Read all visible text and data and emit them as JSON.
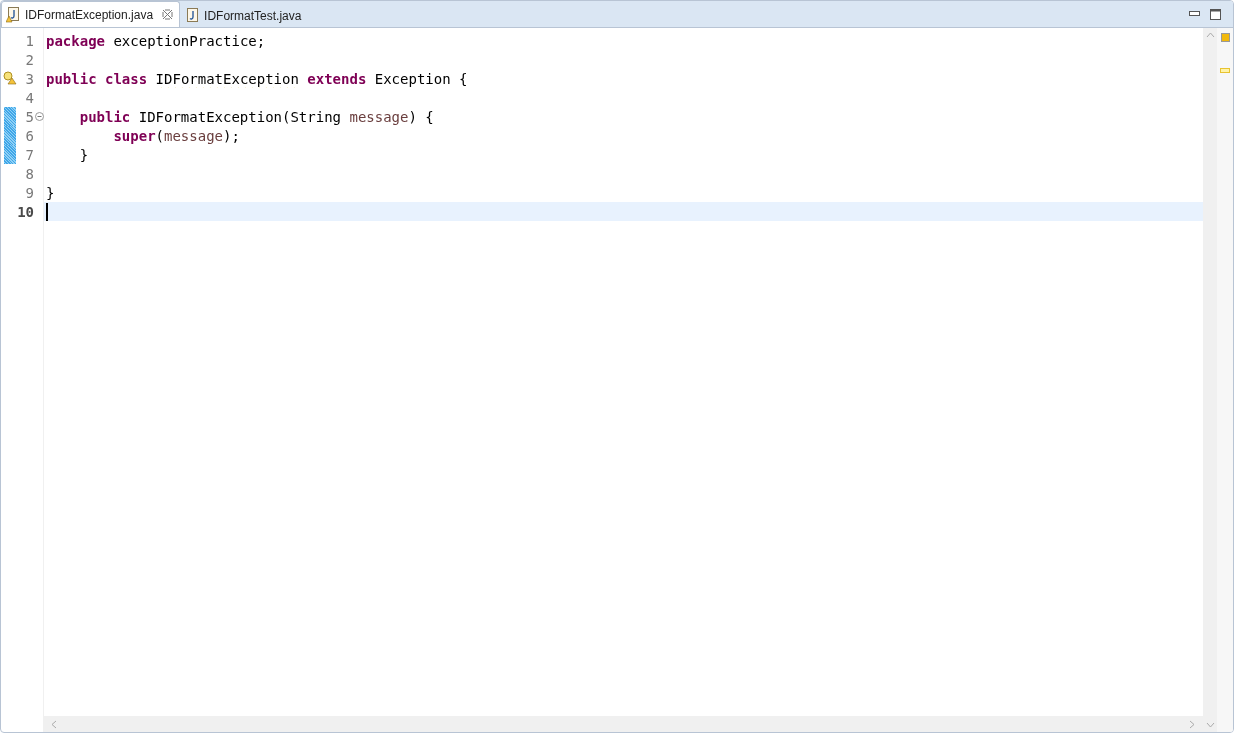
{
  "tabs": [
    {
      "label": "IDFormatException.java",
      "selected": true,
      "warning": true
    },
    {
      "label": "IDFormatTest.java",
      "selected": false,
      "warning": false
    }
  ],
  "lines": [
    {
      "number": "1",
      "changed": false,
      "warning": false,
      "folding": false,
      "current": false,
      "tokens": [
        {
          "kind": "keyword",
          "text": "package"
        },
        {
          "kind": "plain",
          "text": " exceptionPractice;"
        }
      ]
    },
    {
      "number": "2",
      "changed": false,
      "warning": false,
      "folding": false,
      "current": false
    },
    {
      "number": "3",
      "changed": false,
      "warning": true,
      "folding": false,
      "current": false,
      "tokens": [
        {
          "kind": "keyword",
          "text": "public"
        },
        {
          "kind": "keyword",
          "text": " class "
        },
        {
          "kind": "warned",
          "text": "IDFormatException"
        },
        {
          "kind": "keyword",
          "text": " extends"
        },
        {
          "kind": "plain",
          "text": " Exception {"
        }
      ]
    },
    {
      "number": "4",
      "changed": false,
      "warning": false,
      "folding": false,
      "current": false
    },
    {
      "number": "5",
      "changed": true,
      "warning": false,
      "folding": true,
      "current": false,
      "tokens": [
        {
          "kind": "keyword",
          "text": "    public"
        },
        {
          "kind": "plain",
          "text": " IDFormatException(String "
        },
        {
          "kind": "param",
          "text": "message"
        },
        {
          "kind": "plain",
          "text": ") {"
        }
      ]
    },
    {
      "number": "6",
      "changed": true,
      "warning": false,
      "folding": false,
      "current": false,
      "tokens": [
        {
          "kind": "keyword",
          "text": "        super"
        },
        {
          "kind": "plain",
          "text": "("
        },
        {
          "kind": "param",
          "text": "message"
        },
        {
          "kind": "plain",
          "text": ");"
        }
      ]
    },
    {
      "number": "7",
      "changed": true,
      "warning": false,
      "folding": false,
      "current": false,
      "tokens": [
        {
          "kind": "plain",
          "text": "    }"
        }
      ]
    },
    {
      "number": "8",
      "changed": false,
      "warning": false,
      "folding": false,
      "current": false
    },
    {
      "number": "9",
      "changed": false,
      "warning": false,
      "folding": false,
      "current": false,
      "tokens": [
        {
          "kind": "plain",
          "text": "}"
        }
      ]
    },
    {
      "number": "10",
      "changed": false,
      "warning": false,
      "folding": false,
      "current": true
    }
  ]
}
